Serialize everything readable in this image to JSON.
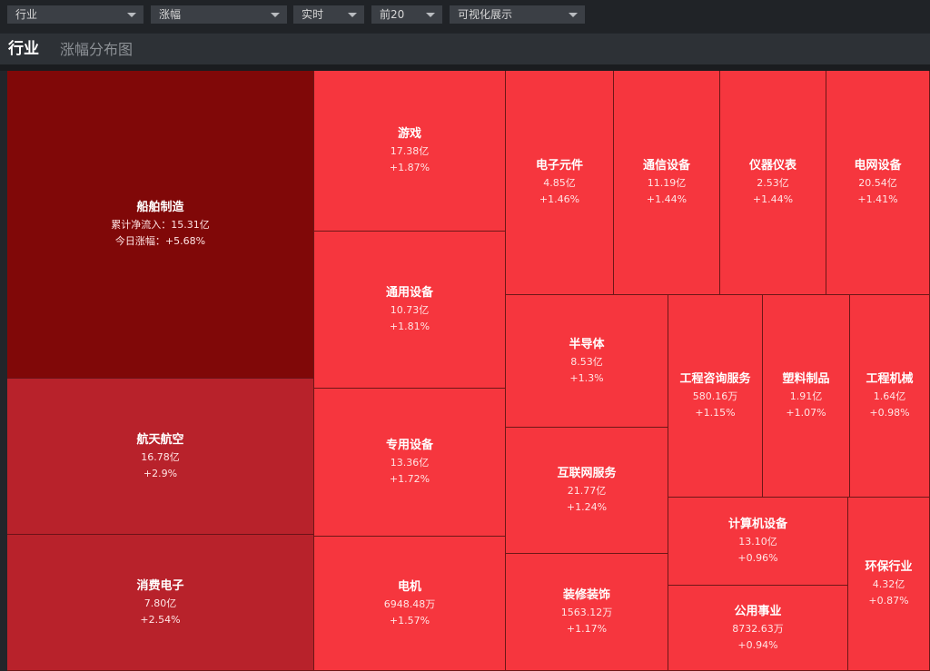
{
  "toolbar": {
    "dropdowns": [
      {
        "label": "行业"
      },
      {
        "label": "涨幅"
      },
      {
        "label": "实时"
      },
      {
        "label": "前20"
      },
      {
        "label": "可视化展示"
      }
    ]
  },
  "header": {
    "title": "行业",
    "subtitle": "涨幅分布图"
  },
  "colors": {
    "deep": "#800808",
    "medium": "#b8222b",
    "bright": "#f6363e",
    "border": "#6d1717"
  },
  "treemap": {
    "cells": [
      {
        "name": "船舶制造",
        "line1": "累计净流入：15.31亿",
        "line2": "今日涨幅：+5.68%",
        "change": 5.68
      },
      {
        "name": "航天航空",
        "line1": "16.78亿",
        "line2": "+2.9%",
        "change": 2.9
      },
      {
        "name": "消费电子",
        "line1": "7.80亿",
        "line2": "+2.54%",
        "change": 2.54
      },
      {
        "name": "游戏",
        "line1": "17.38亿",
        "line2": "+1.87%",
        "change": 1.87
      },
      {
        "name": "通用设备",
        "line1": "10.73亿",
        "line2": "+1.81%",
        "change": 1.81
      },
      {
        "name": "专用设备",
        "line1": "13.36亿",
        "line2": "+1.72%",
        "change": 1.72
      },
      {
        "name": "电机",
        "line1": "6948.48万",
        "line2": "+1.57%",
        "change": 1.57
      },
      {
        "name": "电子元件",
        "line1": "4.85亿",
        "line2": "+1.46%",
        "change": 1.46
      },
      {
        "name": "通信设备",
        "line1": "11.19亿",
        "line2": "+1.44%",
        "change": 1.44
      },
      {
        "name": "仪器仪表",
        "line1": "2.53亿",
        "line2": "+1.44%",
        "change": 1.44
      },
      {
        "name": "电网设备",
        "line1": "20.54亿",
        "line2": "+1.41%",
        "change": 1.41
      },
      {
        "name": "半导体",
        "line1": "8.53亿",
        "line2": "+1.3%",
        "change": 1.3
      },
      {
        "name": "互联网服务",
        "line1": "21.77亿",
        "line2": "+1.24%",
        "change": 1.24
      },
      {
        "name": "装修装饰",
        "line1": "1563.12万",
        "line2": "+1.17%",
        "change": 1.17
      },
      {
        "name": "工程咨询服务",
        "line1": "580.16万",
        "line2": "+1.15%",
        "change": 1.15
      },
      {
        "name": "塑料制品",
        "line1": "1.91亿",
        "line2": "+1.07%",
        "change": 1.07
      },
      {
        "name": "工程机械",
        "line1": "1.64亿",
        "line2": "+0.98%",
        "change": 0.98
      },
      {
        "name": "计算机设备",
        "line1": "13.10亿",
        "line2": "+0.96%",
        "change": 0.96
      },
      {
        "name": "公用事业",
        "line1": "8732.63万",
        "line2": "+0.94%",
        "change": 0.94
      },
      {
        "name": "环保行业",
        "line1": "4.32亿",
        "line2": "+0.87%",
        "change": 0.87
      }
    ]
  }
}
